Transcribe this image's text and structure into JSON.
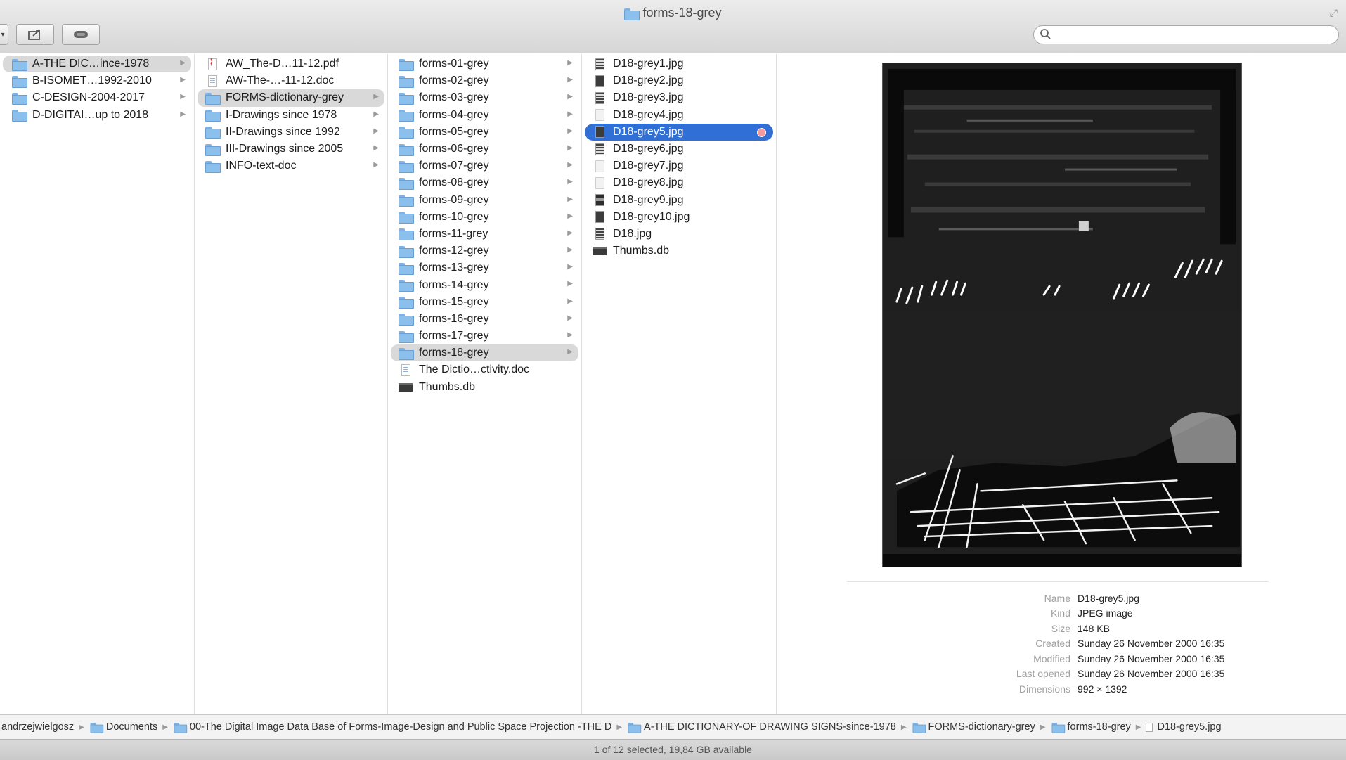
{
  "window": {
    "title": "forms-18-grey"
  },
  "toolbar": {
    "search_placeholder": ""
  },
  "columns": [
    {
      "items": [
        {
          "label": "A-THE DIC…ince-1978",
          "icon": "folder-icon",
          "selected": "grey"
        },
        {
          "label": "B-ISOMET…1992-2010",
          "icon": "folder-icon"
        },
        {
          "label": "C-DESIGN-2004-2017",
          "icon": "folder-icon"
        },
        {
          "label": "D-DIGITAI…up to 2018",
          "icon": "folder-icon"
        }
      ]
    },
    {
      "items": [
        {
          "label": "AW_The-D…11-12.pdf",
          "icon": "pdf-icon"
        },
        {
          "label": "AW-The-…-11-12.doc",
          "icon": "doc-icon"
        },
        {
          "label": "FORMS-dictionary-grey",
          "icon": "folder-icon",
          "selected": "grey"
        },
        {
          "label": "I-Drawings since 1978",
          "icon": "folder-icon"
        },
        {
          "label": "II-Drawings since 1992",
          "icon": "folder-icon"
        },
        {
          "label": "III-Drawings since 2005",
          "icon": "folder-icon"
        },
        {
          "label": "INFO-text-doc",
          "icon": "folder-icon"
        }
      ]
    },
    {
      "items": [
        {
          "label": "forms-01-grey",
          "icon": "folder-icon"
        },
        {
          "label": "forms-02-grey",
          "icon": "folder-icon"
        },
        {
          "label": "forms-03-grey",
          "icon": "folder-icon"
        },
        {
          "label": "forms-04-grey",
          "icon": "folder-icon"
        },
        {
          "label": "forms-05-grey",
          "icon": "folder-icon"
        },
        {
          "label": "forms-06-grey",
          "icon": "folder-icon"
        },
        {
          "label": "forms-07-grey",
          "icon": "folder-icon"
        },
        {
          "label": "forms-08-grey",
          "icon": "folder-icon"
        },
        {
          "label": "forms-09-grey",
          "icon": "folder-icon"
        },
        {
          "label": "forms-10-grey",
          "icon": "folder-icon"
        },
        {
          "label": "forms-11-grey",
          "icon": "folder-icon"
        },
        {
          "label": "forms-12-grey",
          "icon": "folder-icon"
        },
        {
          "label": "forms-13-grey",
          "icon": "folder-icon"
        },
        {
          "label": "forms-14-grey",
          "icon": "folder-icon"
        },
        {
          "label": "forms-15-grey",
          "icon": "folder-icon"
        },
        {
          "label": "forms-16-grey",
          "icon": "folder-icon"
        },
        {
          "label": "forms-17-grey",
          "icon": "folder-icon"
        },
        {
          "label": "forms-18-grey",
          "icon": "folder-icon",
          "selected": "grey"
        },
        {
          "label": "The Dictio…ctivity.doc",
          "icon": "doc-icon"
        },
        {
          "label": "Thumbs.db",
          "icon": "db-file-icon"
        }
      ]
    },
    {
      "items": [
        {
          "label": "D18-grey1.jpg",
          "icon": "image-thumb-icon"
        },
        {
          "label": "D18-grey2.jpg",
          "icon": "image-thumb-icon"
        },
        {
          "label": "D18-grey3.jpg",
          "icon": "image-thumb-icon"
        },
        {
          "label": "D18-grey4.jpg",
          "icon": "image-thumb-icon"
        },
        {
          "label": "D18-grey5.jpg",
          "icon": "image-thumb-icon",
          "selected": "blue",
          "tag_color": "#f39aa0"
        },
        {
          "label": "D18-grey6.jpg",
          "icon": "image-thumb-icon"
        },
        {
          "label": "D18-grey7.jpg",
          "icon": "image-thumb-icon"
        },
        {
          "label": "D18-grey8.jpg",
          "icon": "image-thumb-icon"
        },
        {
          "label": "D18-grey9.jpg",
          "icon": "image-thumb-icon"
        },
        {
          "label": "D18-grey10.jpg",
          "icon": "image-thumb-icon"
        },
        {
          "label": "D18.jpg",
          "icon": "image-thumb-icon"
        },
        {
          "label": "Thumbs.db",
          "icon": "db-file-icon"
        }
      ]
    }
  ],
  "preview": {
    "meta": [
      {
        "key": "Name",
        "value": "D18-grey5.jpg"
      },
      {
        "key": "Kind",
        "value": "JPEG image"
      },
      {
        "key": "Size",
        "value": "148 KB"
      },
      {
        "key": "Created",
        "value": "Sunday 26 November 2000 16:35"
      },
      {
        "key": "Modified",
        "value": "Sunday 26 November 2000 16:35"
      },
      {
        "key": "Last opened",
        "value": "Sunday 26 November 2000 16:35"
      },
      {
        "key": "Dimensions",
        "value": "992 × 1392"
      }
    ]
  },
  "pathbar": [
    {
      "label": "andrzejwielgosz",
      "icon": "none"
    },
    {
      "label": "Documents",
      "icon": "folder-icon"
    },
    {
      "label": "00-The Digital Image Data Base of Forms-Image-Design and Public Space Projection -THE D",
      "icon": "folder-icon"
    },
    {
      "label": "A-THE DICTIONARY-OF DRAWING SIGNS-since-1978",
      "icon": "folder-icon"
    },
    {
      "label": "FORMS-dictionary-grey",
      "icon": "folder-icon"
    },
    {
      "label": "forms-18-grey",
      "icon": "folder-icon"
    },
    {
      "label": "D18-grey5.jpg",
      "icon": "file-icon"
    }
  ],
  "status": {
    "text": "1 of 12 selected, 19,84 GB available"
  },
  "colors": {
    "selection_blue": "#2f6fd6",
    "selection_grey": "#d9d9d9",
    "folder_blue": "#8cc0ec",
    "tag_red": "#f39aa0"
  }
}
